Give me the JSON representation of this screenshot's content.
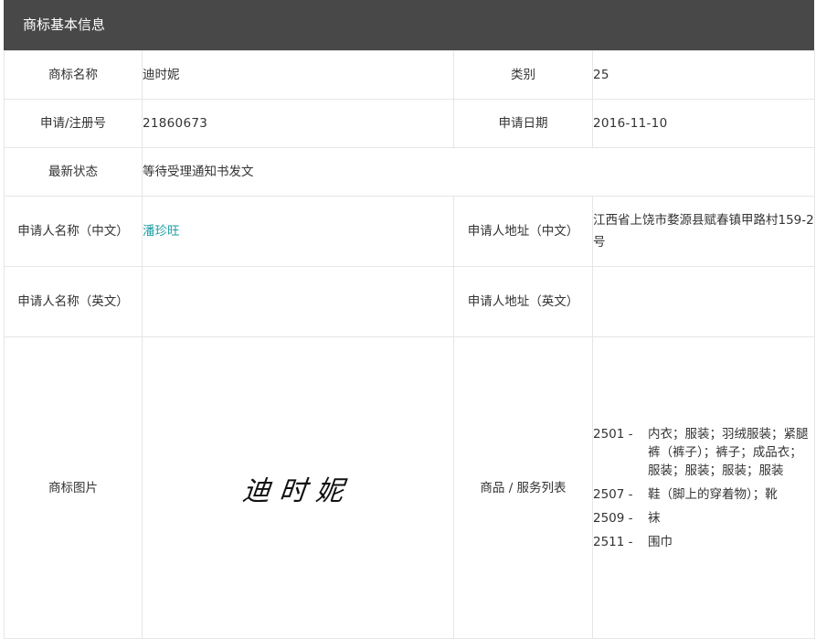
{
  "header": {
    "title": "商标基本信息"
  },
  "rows": {
    "name_label": "商标名称",
    "name_value": "迪时妮",
    "class_label": "类别",
    "class_value": "25",
    "regno_label": "申请/注册号",
    "regno_value": "21860673",
    "date_label": "申请日期",
    "date_value": "2016-11-10",
    "status_label": "最新状态",
    "status_value": "等待受理通知书发文",
    "applicant_cn_label": "申请人名称（中文）",
    "applicant_cn_value": "潘珍旺",
    "address_cn_label": "申请人地址（中文）",
    "address_cn_value": "江西省上饶市婺源县赋春镇甲路村159-2号",
    "applicant_en_label": "申请人名称（英文）",
    "applicant_en_value": "",
    "address_en_label": "申请人地址（英文）",
    "address_en_value": "",
    "image_label": "商标图片",
    "image_text": "迪时妮",
    "goods_label": "商品 / 服务列表"
  },
  "goods": [
    {
      "code": "2501 -",
      "desc": "内衣；服装；羽绒服装；紧腿裤（裤子）；裤子；成品衣；服装；服装；服装；服装"
    },
    {
      "code": "2507 -",
      "desc": "鞋（脚上的穿着物）；靴"
    },
    {
      "code": "2509 -",
      "desc": "袜"
    },
    {
      "code": "2511 -",
      "desc": "围巾"
    }
  ]
}
